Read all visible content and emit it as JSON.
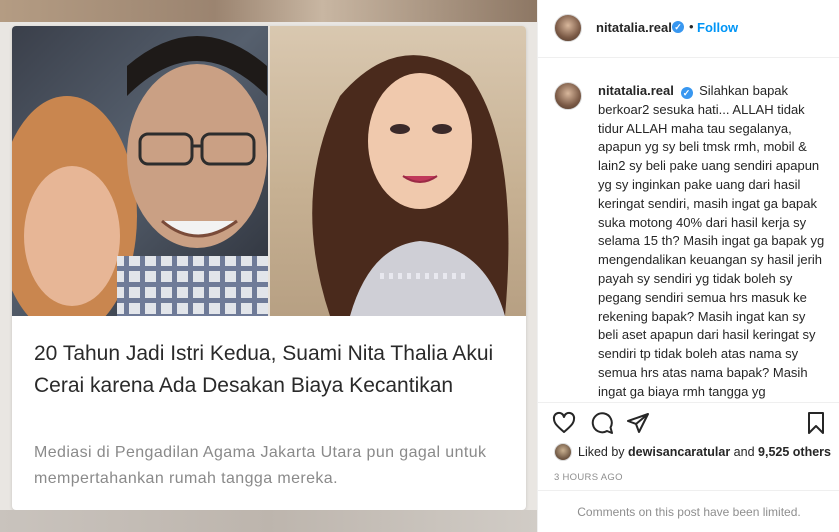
{
  "post": {
    "headline": "20 Tahun Jadi Istri Kedua, Suami Nita Thalia Akui Cerai karena Ada Desakan Biaya Kecantikan",
    "description": "Mediasi di Pengadilan Agama Jakarta Utara pun gagal untuk mempertahankan rumah tangga mereka."
  },
  "header": {
    "username": "nitatalia.real",
    "separator": "•",
    "follow_label": "Follow",
    "more_icon": "ellipsis-icon"
  },
  "caption": {
    "username": "nitatalia.real",
    "text": "Silahkan bapak berkoar2 sesuka hati... ALLAH tidak tidur ALLAH maha tau segalanya, apapun yg sy beli tmsk rmh, mobil & lain2 sy beli pake uang sendiri apapun yg sy inginkan pake uang dari hasil keringat sendiri, masih ingat ga bapak suka motong 40% dari hasil kerja sy selama 15 th? Masih ingat ga bapak yg mengendalikan keuangan sy hasil jerih payah sy sendiri yg tidak boleh sy pegang sendiri semua hrs masuk ke rekening bapak? Masih ingat kan sy beli aset apapun dari hasil keringat sy sendiri tp tidak boleh atas nama sy semua hrs atas nama bapak? Masih ingat ga biaya rmh tangga yg seharusnya menjadi kewajiban bapak tp bapak hutangkan ke sy & harus sy ganti? Masih ingat ga beberapa kali sy"
  },
  "likes": {
    "prefix": "Liked by",
    "user": "dewisancaratular",
    "joiner": "and",
    "count": "9,525 others"
  },
  "timestamp": "3 HOURS AGO",
  "comments_notice": "Comments on this post have been limited.",
  "icons": [
    "heart-icon",
    "comment-icon",
    "share-icon",
    "bookmark-icon",
    "verified-badge-icon"
  ],
  "colors": {
    "accent": "#0095f6",
    "verified": "#3897f0",
    "text": "#262626",
    "muted": "#8e8e8e"
  }
}
